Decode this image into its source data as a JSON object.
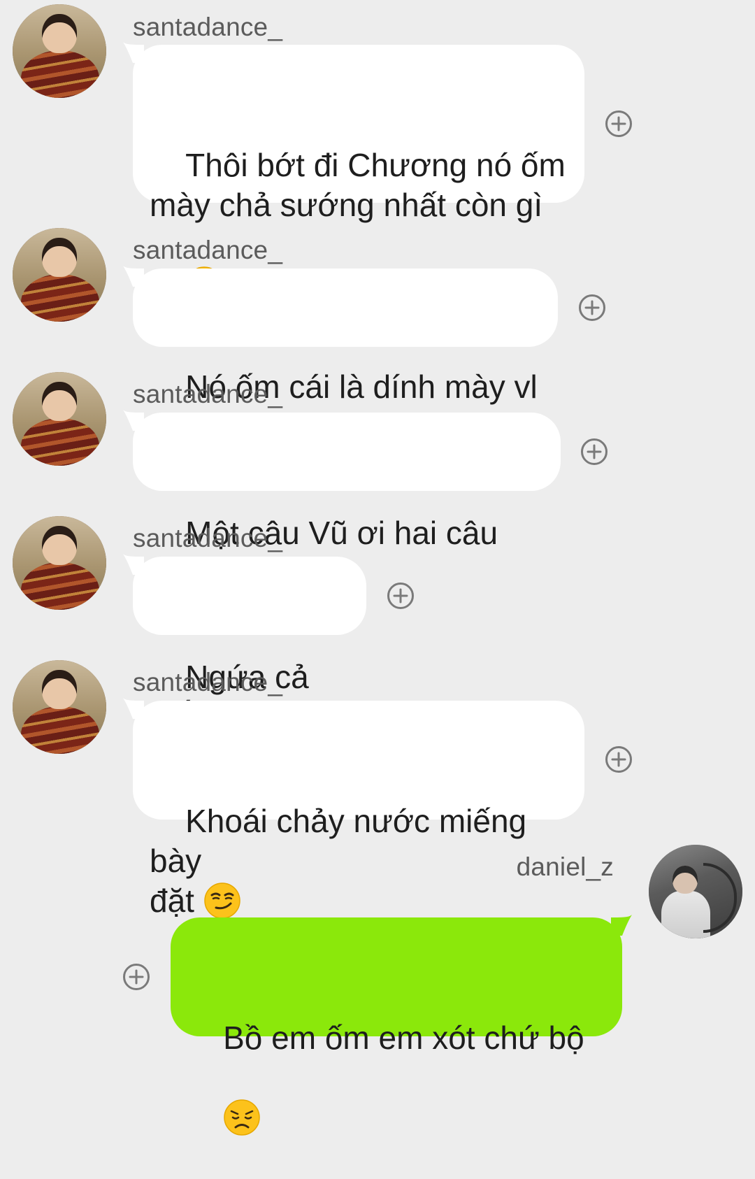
{
  "conversation": {
    "messages": [
      {
        "sender": "santadance_",
        "text": "Thôi bớt đi Chương nó ốm\nmày chả sướng nhất còn gì",
        "emoji": "slightly-smiling-face-emoji"
      },
      {
        "sender": "santadance_",
        "text": "Nó ốm cái là dính mày vl :)"
      },
      {
        "sender": "santadance_",
        "text": "Một câu Vũ ơi hai câu Vũ à"
      },
      {
        "sender": "santadance_",
        "text": "Ngứa cả mắt"
      },
      {
        "sender": "santadance_",
        "text": "Khoái chảy nước miếng bày\nđặt ",
        "emoji": "smirking-face-emoji"
      },
      {
        "sender": "daniel_z",
        "text": "Bồ em ốm em xót chứ bộ",
        "emoji": "disappointed-face-emoji"
      }
    ]
  },
  "colors": {
    "background": "#ededed",
    "incoming_bubble": "#ffffff",
    "outgoing_bubble": "#8be80b",
    "sender_text": "#5b5b5b",
    "message_text": "#1e1e1e",
    "icon_gray": "#7a7a7a"
  }
}
